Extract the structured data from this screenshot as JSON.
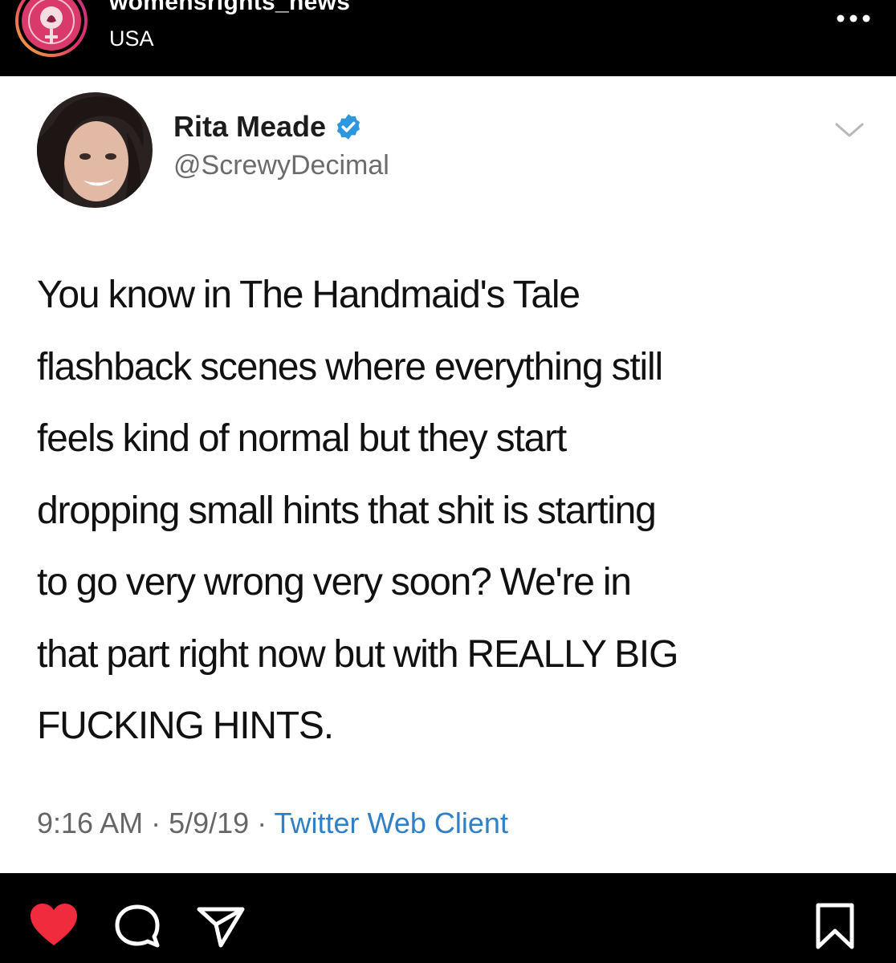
{
  "instagram": {
    "username": "womensrights_news",
    "location": "USA",
    "icons": {
      "avatar": "womensrights-logo",
      "more": "more-dots-icon",
      "like": "heart-icon",
      "comment": "comment-icon",
      "share": "send-icon",
      "save": "bookmark-icon"
    },
    "like_color": "#ef2b3d"
  },
  "tweet": {
    "display_name": "Rita Meade",
    "handle": "@ScrewyDecimal",
    "verified": true,
    "verified_color": "#2c97de",
    "text_lines": [
      "You know in The Handmaid's Tale",
      "flashback scenes where everything still",
      "feels kind of normal but they start",
      "dropping small hints that shit is starting",
      "to go very wrong very soon? We're in",
      "that part right now but with REALLY BIG",
      "FUCKING HINTS."
    ],
    "time": "9:16 AM",
    "date": "5/9/19",
    "source": "Twitter Web Client",
    "separator": " · "
  }
}
